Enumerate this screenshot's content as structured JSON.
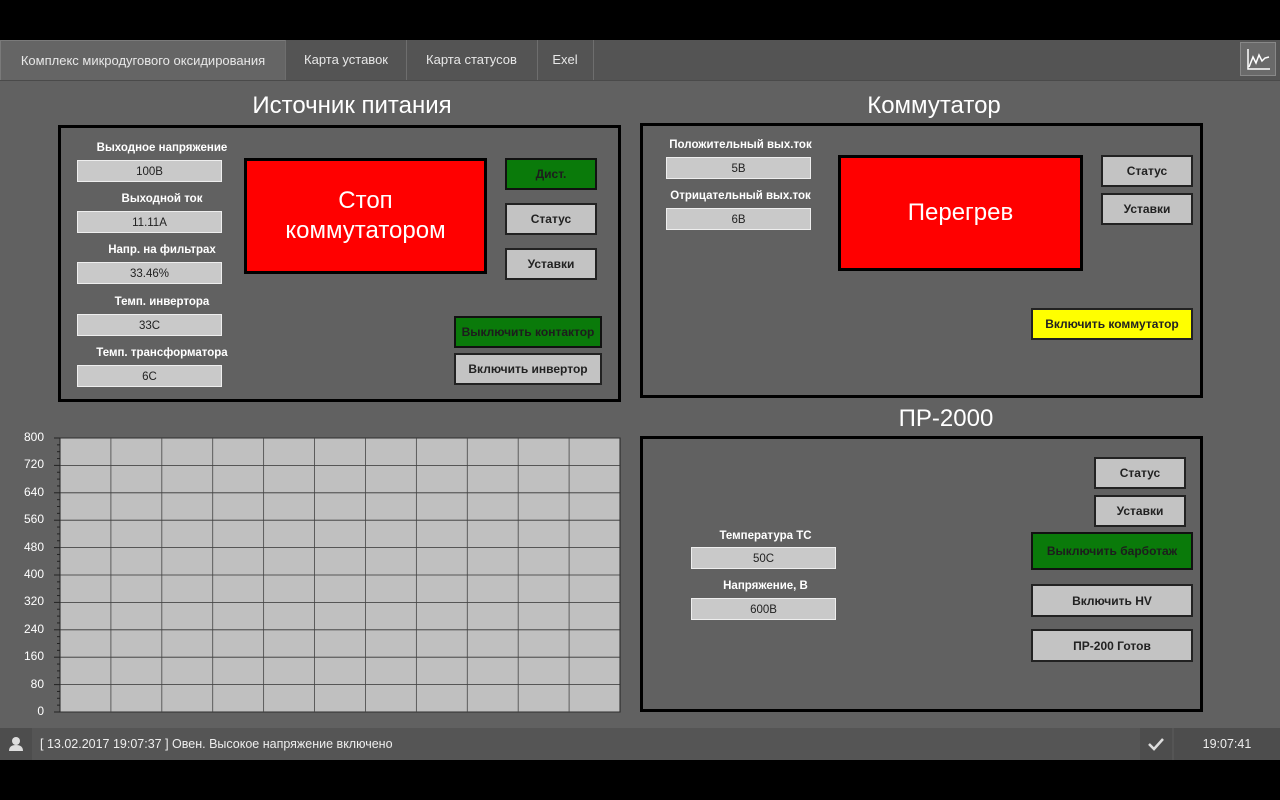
{
  "tabs": [
    {
      "label": "Комплекс микродугового оксидирования"
    },
    {
      "label": "Карта уставок"
    },
    {
      "label": "Карта статусов"
    },
    {
      "label": "Exel"
    }
  ],
  "icons": {
    "trend": "chart-trend-icon",
    "user": "user-icon",
    "ack": "check-icon"
  },
  "power": {
    "title": "Источник питания",
    "fields": [
      {
        "label": "Выходное напряжение",
        "value": "100В"
      },
      {
        "label": "Выходной ток",
        "value": "11.11А"
      },
      {
        "label": "Напр. на фильтрах",
        "value": "33.46%"
      },
      {
        "label": "Темп. инвертора",
        "value": "33С"
      },
      {
        "label": "Темп. трансформатора",
        "value": "6С"
      }
    ],
    "alarm_line1": "Стоп",
    "alarm_line2": "коммутатором",
    "btn_remote": "Дист.",
    "btn_status": "Статус",
    "btn_settings": "Уставки",
    "btn_contactor": "Выключить контактор",
    "btn_inverter": "Включить инвертор"
  },
  "switch": {
    "title": "Коммутатор",
    "fields": [
      {
        "label": "Положительный вых.ток",
        "value": "5В"
      },
      {
        "label": "Отрицательный вых.ток",
        "value": "6В"
      }
    ],
    "alarm": "Перегрев",
    "btn_status": "Статус",
    "btn_settings": "Уставки",
    "btn_enable": "Включить коммутатор"
  },
  "pr": {
    "title": "ПР-2000",
    "fields": [
      {
        "label": "Температура ТС",
        "value": "50С"
      },
      {
        "label": "Напряжение, В",
        "value": "600В"
      }
    ],
    "btn_status": "Статус",
    "btn_settings": "Уставки",
    "btn_bubbling": "Выключить барботаж",
    "btn_hv": "Включить HV",
    "btn_ready": "ПР-200 Готов"
  },
  "chart_data": {
    "type": "line",
    "y_ticks": [
      "800",
      "720",
      "640",
      "560",
      "480",
      "400",
      "320",
      "240",
      "160",
      "80",
      "0"
    ],
    "ylim": [
      0,
      800
    ],
    "grid": true,
    "series": []
  },
  "status": {
    "message": "[ 13.02.2017  19:07:37 ]  Овен. Высокое напряжение включено",
    "time": "19:07:41"
  },
  "colors": {
    "alarm": "#ff0000",
    "green": "#0a7a0a",
    "yellow": "#ffff00",
    "background": "#616161"
  }
}
